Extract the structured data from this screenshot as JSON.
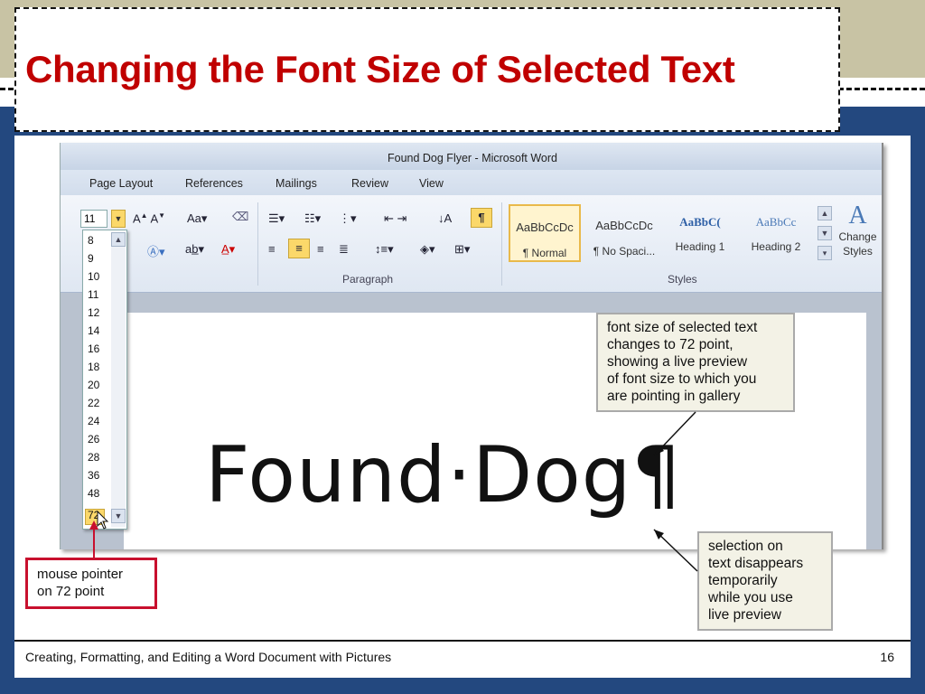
{
  "slide": {
    "title": "Changing the Font Size of Selected Text",
    "footer_left": "Creating, Formatting, and Editing a Word Document with Pictures",
    "page_number": "16"
  },
  "word": {
    "window_title": "Found Dog Flyer  -  Microsoft Word",
    "tabs": [
      "Page Layout",
      "References",
      "Mailings",
      "Review",
      "View"
    ],
    "font_size_value": "11",
    "groups": {
      "paragraph": "Paragraph",
      "styles": "Styles"
    },
    "styles": [
      {
        "preview": "AaBbCcDc",
        "name": "¶ Normal"
      },
      {
        "preview": "AaBbCcDc",
        "name": "¶ No Spaci..."
      },
      {
        "preview": "AaBbC(",
        "name": "Heading 1"
      },
      {
        "preview": "AaBbCc",
        "name": "Heading 2"
      }
    ],
    "change_styles": "Change Styles",
    "font_sizes": [
      "8",
      "9",
      "10",
      "11",
      "12",
      "14",
      "16",
      "18",
      "20",
      "22",
      "24",
      "26",
      "28",
      "36",
      "48",
      "72"
    ],
    "document_text": "Found·Dog¶"
  },
  "callouts": {
    "top": [
      "font size of selected text",
      "changes to 72 point,",
      "showing a live preview",
      "of font size to which you",
      "are pointing in gallery"
    ],
    "bottom": [
      "selection on",
      "text disappears",
      "temporarily",
      "while you use",
      "live preview"
    ],
    "pointer": [
      "mouse pointer",
      "on 72 point"
    ]
  },
  "colors": {
    "title": "#c00000",
    "slide_bg": "#23487f",
    "accent_red": "#c8102e",
    "highlight": "#fbd86a"
  }
}
